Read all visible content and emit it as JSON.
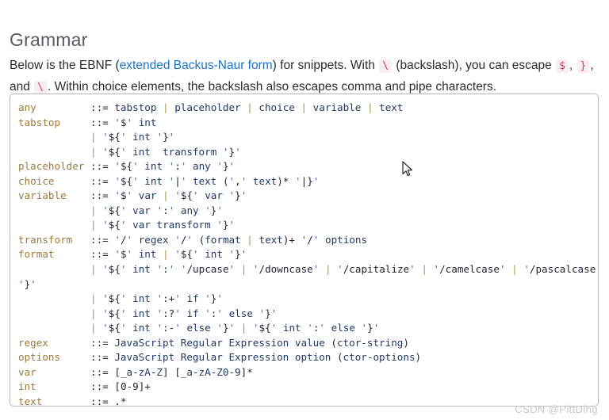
{
  "heading": "Grammar",
  "intro": {
    "part1": "Below is the EBNF (",
    "link": "extended Backus-Naur form",
    "part2": ") for snippets. With ",
    "code_backslash_1": "\\",
    "part3": " (backslash), you can escape ",
    "code_dollar": "$",
    "comma1": ", ",
    "code_brace": "}",
    "comma2": ", and ",
    "code_backslash_2": "\\",
    "part4": ". Within choice elements, the backslash also escapes comma and pipe characters."
  },
  "code": {
    "language": "ebnf",
    "lines": [
      "any         ::= tabstop | placeholder | choice | variable | text",
      "tabstop     ::= '$' int",
      "            | '${' int '}'",
      "            | '${' int  transform '}'",
      "placeholder ::= '${' int ':' any '}'",
      "choice      ::= '${' int '|' text (',' text)* '|}'",
      "variable    ::= '$' var | '${' var '}'",
      "            | '${' var ':' any '}'",
      "            | '${' var transform '}'",
      "transform   ::= '/' regex '/' (format | text)+ '/' options",
      "format      ::= '$' int | '${' int '}'",
      "            | '${' int ':' '/upcase' | '/downcase' | '/capitalize' | '/camelcase' | '/pascalcase'",
      "'}'",
      "            | '${' int ':+' if '}'",
      "            | '${' int ':?' if ':' else '}'",
      "            | '${' int ':-' else '}' | '${' int ':' else '}'",
      "regex       ::= JavaScript Regular Expression value (ctor-string)",
      "options     ::= JavaScript Regular Expression option (ctor-options)",
      "var         ::= [_a-zA-Z] [_a-zA-Z0-9]*",
      "int         ::= [0-9]+",
      "text        ::= .*"
    ]
  },
  "watermark": "CSDN @PittDing",
  "colors": {
    "link": "#1a73c8",
    "inline_code_text": "#d6336c",
    "inline_code_bg": "#fbeef2",
    "heading": "#5a5a66",
    "code_border": "#b9b9bd",
    "rule_name": "#9b7a3f",
    "pipe": "#b2924f",
    "identifier": "#1f3a63",
    "quote": "#4169b2",
    "watermark": "#c7c7cc"
  }
}
